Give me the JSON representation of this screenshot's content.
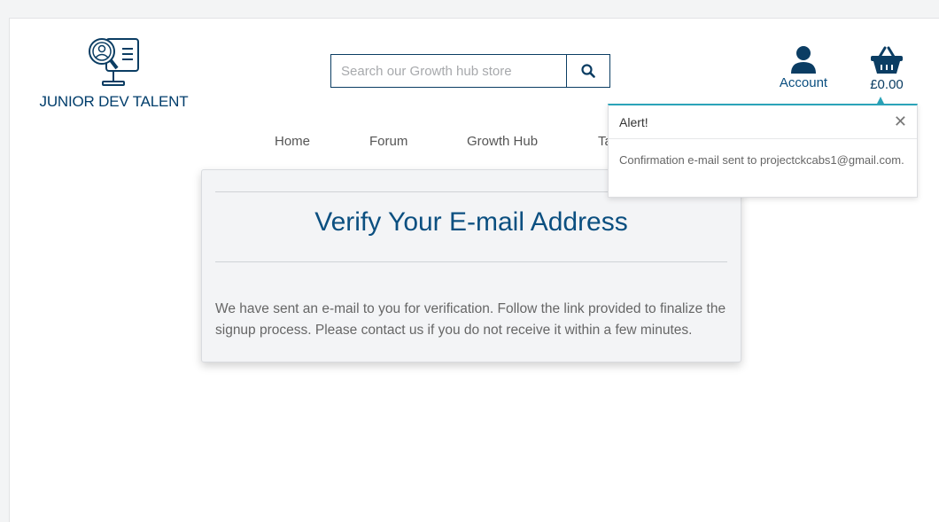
{
  "header": {
    "logo_text": "JUNIOR DEV TALENT",
    "search_placeholder": "Search our Growth hub store",
    "account_label": "Account",
    "cart_total": "£0.00"
  },
  "nav": {
    "items": [
      "Home",
      "Forum",
      "Growth Hub",
      "Ta"
    ]
  },
  "card": {
    "title": "Verify Your E-mail Address",
    "body": "We have sent an e-mail to you for verification. Follow the link provided to finalize the signup process. Please contact us if you do not receive it within a few minutes."
  },
  "alert": {
    "title": "Alert!",
    "message": "Confirmation e-mail sent to projectckcabs1@gmail.com.",
    "close_symbol": "✕"
  },
  "colors": {
    "brand": "#0b3d63",
    "accent": "#2aa3b8"
  },
  "icons": [
    "developer-logo-icon",
    "search-icon",
    "user-icon",
    "basket-icon",
    "close-icon"
  ]
}
